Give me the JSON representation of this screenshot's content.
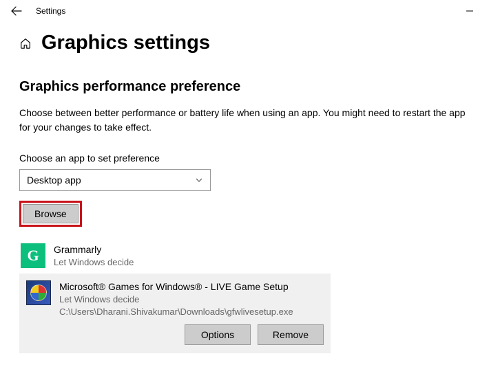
{
  "titlebar": {
    "title": "Settings"
  },
  "page": {
    "heading": "Graphics settings",
    "section_title": "Graphics performance preference",
    "description": "Choose between better performance or battery life when using an app. You might need to restart the app for your changes to take effect.",
    "choose_label": "Choose an app to set preference",
    "select_value": "Desktop app",
    "browse_label": "Browse"
  },
  "apps": [
    {
      "name": "Grammarly",
      "preference": "Let Windows decide",
      "path": null,
      "icon": "grammarly-icon",
      "selected": false
    },
    {
      "name": "Microsoft® Games for Windows® - LIVE Game Setup",
      "preference": "Let Windows decide",
      "path": "C:\\Users\\Dharani.Shivakumar\\Downloads\\gfwlivesetup.exe",
      "icon": "windows-live-icon",
      "selected": true
    }
  ],
  "actions": {
    "options": "Options",
    "remove": "Remove"
  }
}
